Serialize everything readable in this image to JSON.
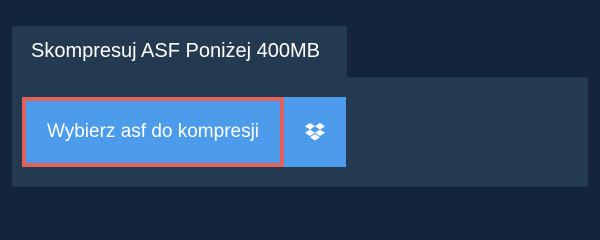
{
  "tab": {
    "title": "Skompresuj ASF Poniżej 400MB"
  },
  "upload": {
    "select_label": "Wybierz asf do kompresji",
    "dropbox_icon": "dropbox-icon"
  },
  "colors": {
    "page_background": "#13253b",
    "panel_background": "#233a50",
    "button_blue": "#4c9ceb",
    "highlight_border": "#e0605a",
    "text": "#ffffff"
  }
}
